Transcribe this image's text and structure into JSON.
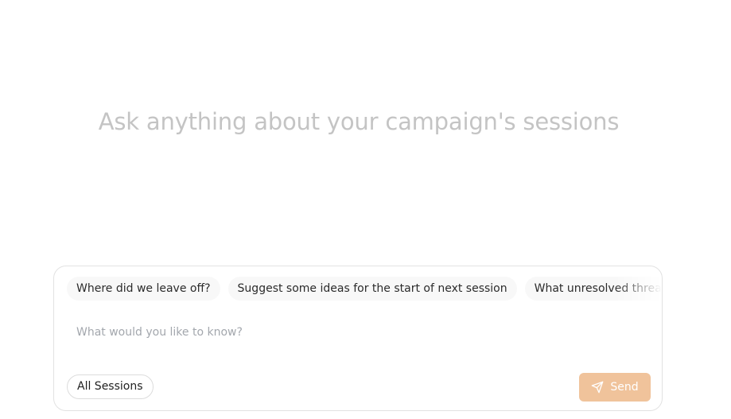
{
  "hero": {
    "title": "Ask anything about your campaign's sessions"
  },
  "composer": {
    "suggestions": [
      "Where did we leave off?",
      "Suggest some ideas for the start of next session",
      "What unresolved threads are"
    ],
    "input": {
      "placeholder": "What would you like to know?",
      "value": ""
    },
    "scope_label": "All Sessions",
    "send_label": "Send",
    "send_icon": "send-icon"
  },
  "colors": {
    "accent": "#f0c39b",
    "title": "#c4c4c4",
    "placeholder": "#a3a7ad",
    "chip_bg": "#f8f8f8"
  }
}
